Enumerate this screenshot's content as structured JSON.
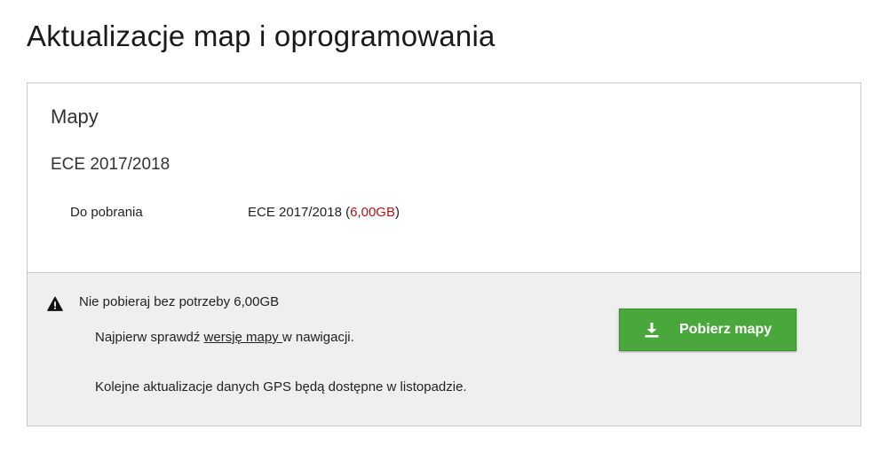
{
  "page": {
    "title": "Aktualizacje map i oprogramowania"
  },
  "maps": {
    "section_title": "Mapy",
    "map_name": "ECE 2017/2018",
    "row": {
      "label": "Do pobrania",
      "value_name": "ECE 2017/2018",
      "value_open": " (",
      "value_size": "6,00GB",
      "value_close": ")"
    }
  },
  "notice": {
    "warning_icon": "warning-icon",
    "warning_text": "Nie pobieraj bez potrzeby 6,00GB",
    "check_prefix": "Najpierw sprawdź ",
    "check_link": "wersję mapy ",
    "check_suffix": "w nawigacji.",
    "gps_text": "Kolejne aktualizacje danych GPS będą dostępne w listopadzie."
  },
  "download_button": {
    "icon": "download-icon",
    "label": "Pobierz mapy"
  },
  "colors": {
    "button_green": "#4aa73c",
    "size_red": "#b01515",
    "notice_bg": "#efefef"
  }
}
